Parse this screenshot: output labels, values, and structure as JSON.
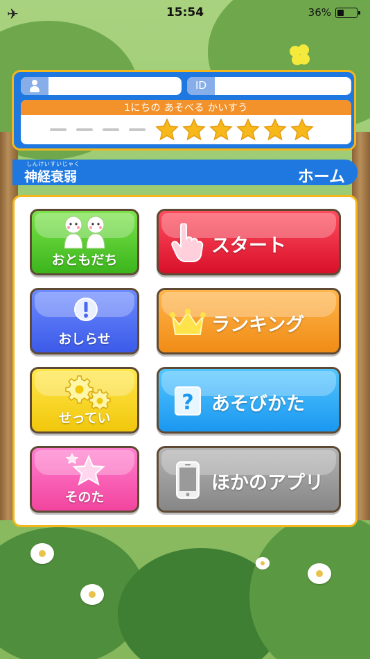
{
  "status_bar": {
    "time": "15:54",
    "battery_percent": "36%",
    "battery_level": 0.36,
    "icons": [
      "airplane-icon",
      "battery-icon"
    ]
  },
  "user_panel": {
    "user_icon": "person-icon",
    "user_name_value": "",
    "id_label": "ID",
    "id_value": "",
    "plays_header": "1にちの あそべる かいすう",
    "plays_used": 4,
    "plays_remaining": 6,
    "plays_total": 10
  },
  "title_bar": {
    "ruby": "しんけいすいじゃく",
    "game_title": "神経衰弱",
    "page_label": "ホーム"
  },
  "menu": {
    "friends_label": "おともだち",
    "news_label": "おしらせ",
    "settings_label": "せってい",
    "other_label": "そのた",
    "start_label": "スタート",
    "ranking_label": "ランキング",
    "howto_label": "あそびかた",
    "other_apps_label": "ほかのアプリ"
  },
  "colors": {
    "panel_blue": "#1f78e0",
    "panel_border": "#f3b71c",
    "friends": "#4fc82c",
    "start": "#e81a33",
    "news": "#4a68f0",
    "ranking": "#f5a02a",
    "settings": "#f5d424",
    "howto": "#2aaaf5",
    "other": "#f75bb5",
    "other_apps": "#9a9a9a",
    "star": "#f7b81c"
  }
}
